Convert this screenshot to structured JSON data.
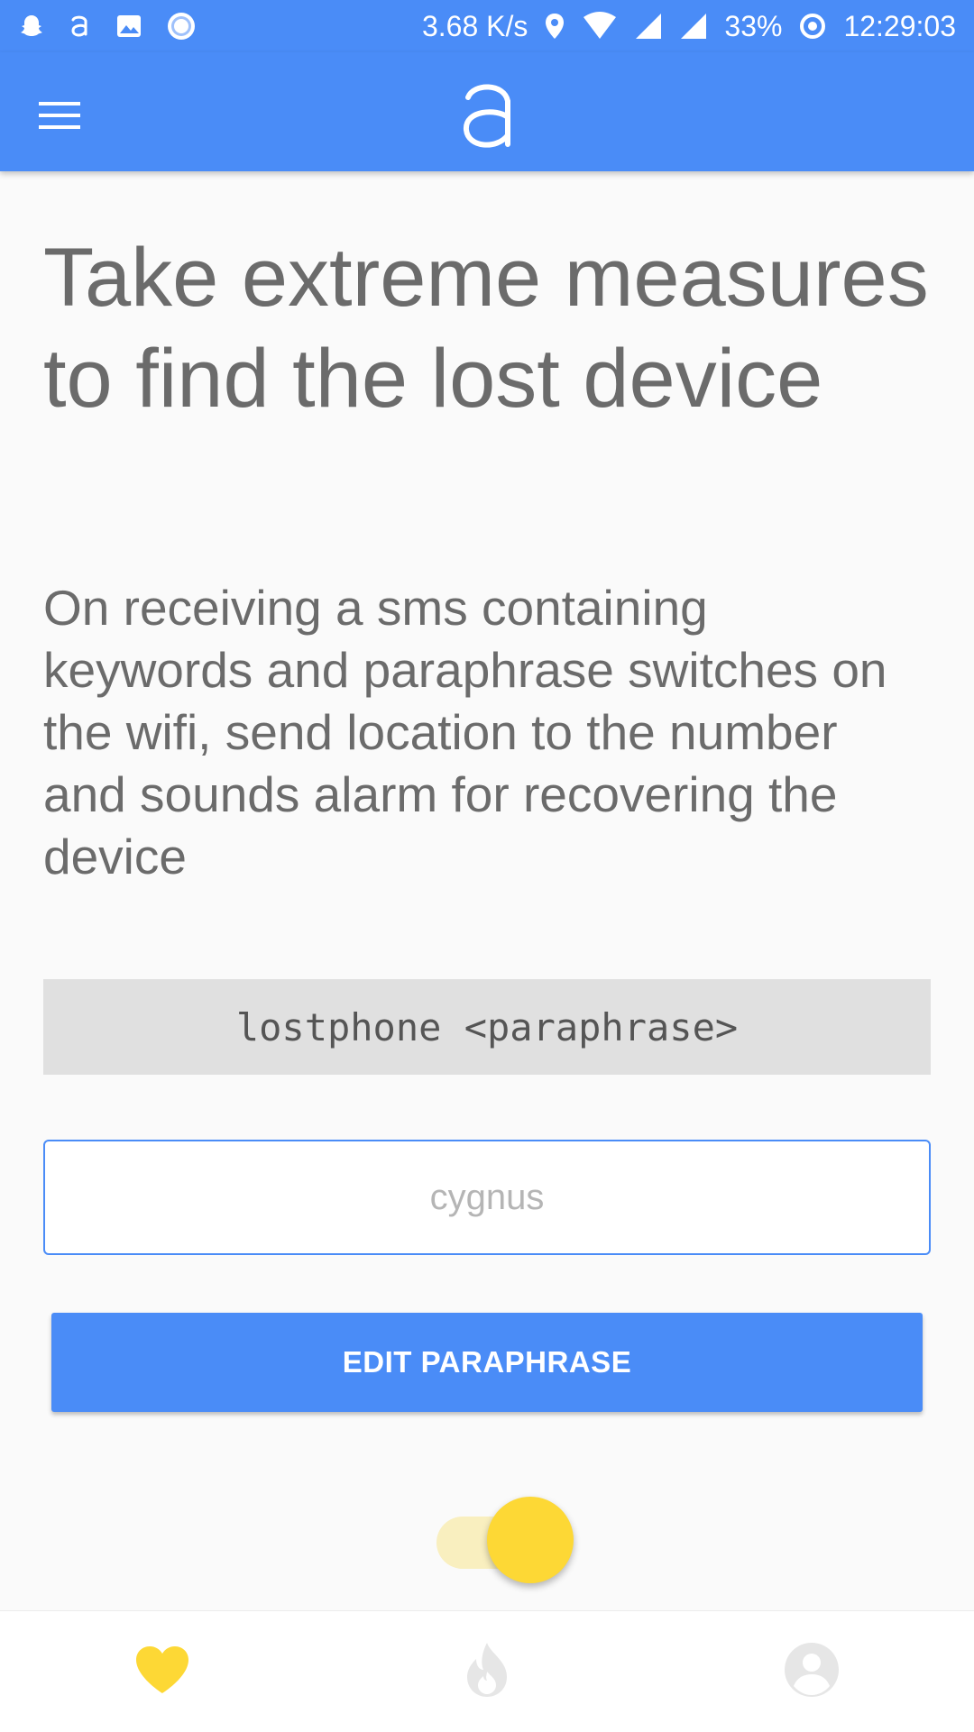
{
  "status_bar": {
    "net_speed": "3.68 K/s",
    "battery": "33%",
    "time": "12:29:03",
    "icons": [
      "snapchat-icon",
      "app-a-icon",
      "image-icon",
      "record-icon",
      "location-icon",
      "wifi-icon",
      "signal-icon",
      "signal-icon",
      "data-saver-icon"
    ]
  },
  "app_bar": {
    "menu_icon": "hamburger-menu-icon",
    "logo_icon": "app-logo-a-icon"
  },
  "main": {
    "headline": "Take extreme measures to find the lost device",
    "description": "On receiving a sms containing keywords and paraphrase switches on the wifi, send location to the number and sounds alarm for recovering the device",
    "command": "lostphone <paraphrase>",
    "paraphrase_input": {
      "value": "",
      "placeholder": "cygnus"
    },
    "edit_button_label": "EDIT PARAPHRASE",
    "toggle": {
      "state": "on"
    }
  },
  "bottom_nav": {
    "items": [
      {
        "icon": "heart-icon",
        "active": true
      },
      {
        "icon": "flame-icon",
        "active": false
      },
      {
        "icon": "account-icon",
        "active": false
      }
    ]
  },
  "colors": {
    "primary": "#4a8cf7",
    "accent": "#fdd835",
    "text": "#6b6b6b",
    "background": "#fafafa"
  }
}
